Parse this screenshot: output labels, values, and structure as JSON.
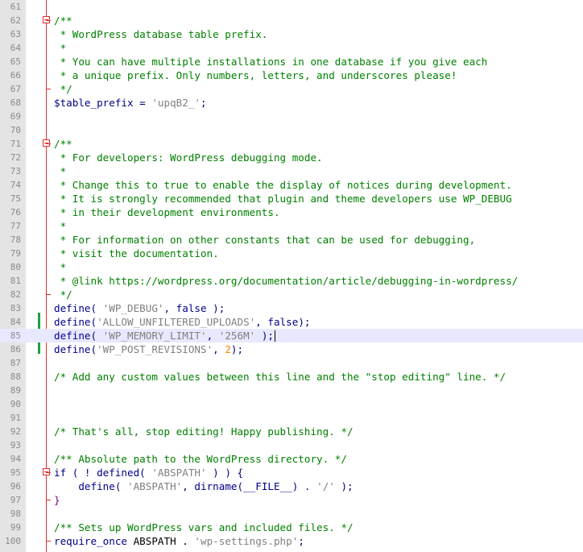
{
  "editor": {
    "lines": [
      {
        "n": "61",
        "segments": []
      },
      {
        "n": "62",
        "fold": "start",
        "segments": [
          {
            "t": "/**",
            "c": "c-comment"
          }
        ]
      },
      {
        "n": "63",
        "segments": [
          {
            "t": " * WordPress database table prefix.",
            "c": "c-comment"
          }
        ]
      },
      {
        "n": "64",
        "segments": [
          {
            "t": " *",
            "c": "c-comment"
          }
        ]
      },
      {
        "n": "65",
        "segments": [
          {
            "t": " * You can have multiple installations in one database if you give each",
            "c": "c-comment"
          }
        ]
      },
      {
        "n": "66",
        "segments": [
          {
            "t": " * a unique prefix. Only numbers, letters, and underscores please!",
            "c": "c-comment"
          }
        ]
      },
      {
        "n": "67",
        "fold": "end",
        "segments": [
          {
            "t": " */",
            "c": "c-comment"
          }
        ]
      },
      {
        "n": "68",
        "segments": [
          {
            "t": "$table_prefix",
            "c": "c-var"
          },
          {
            "t": " = ",
            "c": "c-op"
          },
          {
            "t": "'upqB2_'",
            "c": "c-str"
          },
          {
            "t": ";",
            "c": "c-op"
          }
        ]
      },
      {
        "n": "69",
        "segments": []
      },
      {
        "n": "70",
        "segments": []
      },
      {
        "n": "71",
        "fold": "start",
        "segments": [
          {
            "t": "/**",
            "c": "c-comment"
          }
        ]
      },
      {
        "n": "72",
        "segments": [
          {
            "t": " * For developers: WordPress debugging mode.",
            "c": "c-comment"
          }
        ]
      },
      {
        "n": "73",
        "segments": [
          {
            "t": " *",
            "c": "c-comment"
          }
        ]
      },
      {
        "n": "74",
        "segments": [
          {
            "t": " * Change this to true to enable the display of notices during development.",
            "c": "c-comment"
          }
        ]
      },
      {
        "n": "75",
        "segments": [
          {
            "t": " * It is strongly recommended that plugin and theme developers use WP_DEBUG",
            "c": "c-comment"
          }
        ]
      },
      {
        "n": "76",
        "segments": [
          {
            "t": " * in their development environments.",
            "c": "c-comment"
          }
        ]
      },
      {
        "n": "77",
        "segments": [
          {
            "t": " *",
            "c": "c-comment"
          }
        ]
      },
      {
        "n": "78",
        "segments": [
          {
            "t": " * For information on other constants that can be used for debugging,",
            "c": "c-comment"
          }
        ]
      },
      {
        "n": "79",
        "segments": [
          {
            "t": " * visit the documentation.",
            "c": "c-comment"
          }
        ]
      },
      {
        "n": "80",
        "segments": [
          {
            "t": " *",
            "c": "c-comment"
          }
        ]
      },
      {
        "n": "81",
        "segments": [
          {
            "t": " * @link https://wordpress.org/documentation/article/debugging-in-wordpress/",
            "c": "c-comment"
          }
        ]
      },
      {
        "n": "82",
        "fold": "end",
        "segments": [
          {
            "t": " */",
            "c": "c-comment"
          }
        ]
      },
      {
        "n": "83",
        "segments": [
          {
            "t": "define",
            "c": "c-kw"
          },
          {
            "t": "( ",
            "c": "c-op"
          },
          {
            "t": "'WP_DEBUG'",
            "c": "c-str"
          },
          {
            "t": ", ",
            "c": "c-op"
          },
          {
            "t": "false",
            "c": "c-kw"
          },
          {
            "t": " );",
            "c": "c-op"
          }
        ]
      },
      {
        "n": "84",
        "changed": true,
        "segments": [
          {
            "t": "define",
            "c": "c-kw"
          },
          {
            "t": "(",
            "c": "c-op"
          },
          {
            "t": "'ALLOW_UNFILTERED_UPLOADS'",
            "c": "c-str"
          },
          {
            "t": ", ",
            "c": "c-op"
          },
          {
            "t": "false",
            "c": "c-kw"
          },
          {
            "t": ");",
            "c": "c-op"
          }
        ]
      },
      {
        "n": "85",
        "changed": true,
        "current": true,
        "segments": [
          {
            "t": "define",
            "c": "c-kw"
          },
          {
            "t": "( ",
            "c": "c-op"
          },
          {
            "t": "'WP_MEMORY_LIMIT'",
            "c": "c-str"
          },
          {
            "t": ", ",
            "c": "c-op"
          },
          {
            "t": "'256M'",
            "c": "c-str"
          },
          {
            "t": " );",
            "c": "c-op"
          }
        ]
      },
      {
        "n": "86",
        "changed": true,
        "segments": [
          {
            "t": "define",
            "c": "c-kw"
          },
          {
            "t": "(",
            "c": "c-op"
          },
          {
            "t": "'WP_POST_REVISIONS'",
            "c": "c-str"
          },
          {
            "t": ", ",
            "c": "c-op"
          },
          {
            "t": "2",
            "c": "c-num"
          },
          {
            "t": ");",
            "c": "c-op"
          }
        ]
      },
      {
        "n": "87",
        "segments": []
      },
      {
        "n": "88",
        "segments": [
          {
            "t": "/* Add any custom values between this line and the \"stop editing\" line. */",
            "c": "c-comment"
          }
        ]
      },
      {
        "n": "89",
        "segments": []
      },
      {
        "n": "90",
        "segments": []
      },
      {
        "n": "91",
        "segments": []
      },
      {
        "n": "92",
        "segments": [
          {
            "t": "/* That's all, stop editing! Happy publishing. */",
            "c": "c-comment"
          }
        ]
      },
      {
        "n": "93",
        "segments": []
      },
      {
        "n": "94",
        "segments": [
          {
            "t": "/** Absolute path to the WordPress directory. */",
            "c": "c-comment"
          }
        ]
      },
      {
        "n": "95",
        "fold": "start",
        "segments": [
          {
            "t": "if",
            "c": "c-kw"
          },
          {
            "t": " ( ! ",
            "c": "c-op"
          },
          {
            "t": "defined",
            "c": "c-kw"
          },
          {
            "t": "( ",
            "c": "c-op"
          },
          {
            "t": "'ABSPATH'",
            "c": "c-str"
          },
          {
            "t": " ) ) {",
            "c": "c-op"
          }
        ]
      },
      {
        "n": "96",
        "segments": [
          {
            "t": "    define",
            "c": "c-kw"
          },
          {
            "t": "( ",
            "c": "c-op"
          },
          {
            "t": "'ABSPATH'",
            "c": "c-str"
          },
          {
            "t": ", ",
            "c": "c-op"
          },
          {
            "t": "dirname",
            "c": "c-kw"
          },
          {
            "t": "(",
            "c": "c-op"
          },
          {
            "t": "__FILE__",
            "c": "c-kw"
          },
          {
            "t": ") . ",
            "c": "c-op"
          },
          {
            "t": "'/'",
            "c": "c-str"
          },
          {
            "t": " );",
            "c": "c-op"
          }
        ]
      },
      {
        "n": "97",
        "fold": "end",
        "segments": [
          {
            "t": "}",
            "c": "c-paren"
          }
        ]
      },
      {
        "n": "98",
        "segments": []
      },
      {
        "n": "99",
        "segments": [
          {
            "t": "/** Sets up WordPress vars and included files. */",
            "c": "c-comment"
          }
        ]
      },
      {
        "n": "100",
        "fold": "end",
        "segments": [
          {
            "t": "require_once",
            "c": "c-kw"
          },
          {
            "t": " ABSPATH . ",
            "c": "c-plain"
          },
          {
            "t": "'wp-settings.php'",
            "c": "c-str"
          },
          {
            "t": ";",
            "c": "c-op"
          }
        ]
      }
    ]
  }
}
